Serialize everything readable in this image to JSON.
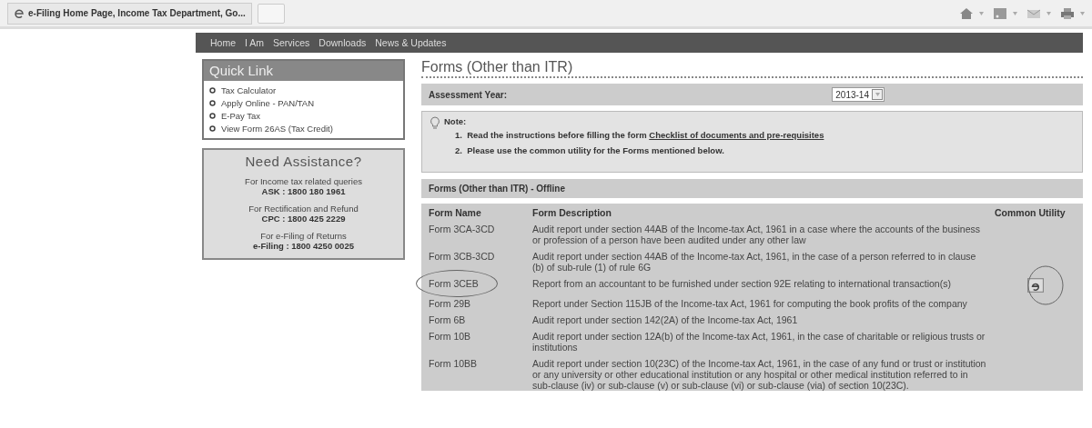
{
  "browser": {
    "tab_title": "e-Filing Home Page, Income Tax Department, Go...",
    "toolbar": [
      {
        "kind": "home"
      },
      {
        "kind": "feed"
      },
      {
        "kind": "mail"
      },
      {
        "kind": "print"
      }
    ]
  },
  "nav": [
    "Home",
    "I Am",
    "Services",
    "Downloads",
    "News & Updates"
  ],
  "quick_link": {
    "title": "Quick Link",
    "items": [
      "Tax Calculator",
      "Apply Online - PAN/TAN",
      "E-Pay Tax",
      "View Form 26AS (Tax Credit)"
    ]
  },
  "assistance": {
    "title": "Need Assistance?",
    "entries": [
      {
        "label": "For Income tax related queries",
        "line": "ASK : 1800 180 1961"
      },
      {
        "label": "For Rectification and Refund",
        "line": "CPC : 1800 425 2229"
      },
      {
        "label": "For e-Filing of Returns",
        "line": "e-Filing : 1800 4250 0025"
      }
    ]
  },
  "page_title": "Forms (Other than ITR)",
  "assessment": {
    "label": "Assessment Year:",
    "value": "2013-14"
  },
  "note": {
    "label": "Note:",
    "items": [
      {
        "number": "1.",
        "text": "Read the instructions before filling the form",
        "link": "Checklist of documents and pre-requisites"
      },
      {
        "number": "2.",
        "text": "Please use the common utility for the Forms mentioned below."
      }
    ]
  },
  "offline": {
    "title": "Forms (Other than ITR) - Offline",
    "columns": [
      "Form Name",
      "Form Description",
      "Common Utility"
    ],
    "rows": [
      {
        "name": "Form 3CA-3CD",
        "description": "Audit report under section 44AB of the Income-tax Act, 1961 in a case where the accounts of the business or profession of a person have been audited under any other law",
        "circled": false,
        "utility": false
      },
      {
        "name": "Form 3CB-3CD",
        "description": "Audit report under section 44AB of the Income-tax Act, 1961, in the case of a person referred to in clause (b) of sub-rule (1) of rule 6G",
        "circled": false,
        "utility": false
      },
      {
        "name": "Form 3CEB",
        "description": "Report from an accountant to be furnished under section 92E relating to international transaction(s)",
        "circled": true,
        "utility": true
      },
      {
        "name": "Form 29B",
        "description": "Report under Section 115JB of the Income-tax Act, 1961 for computing the book profits of the company",
        "circled": false,
        "utility": false
      },
      {
        "name": "Form 6B",
        "description": "Audit report under section 142(2A) of the Income-tax Act, 1961",
        "circled": false,
        "utility": false
      },
      {
        "name": "Form 10B",
        "description": "Audit report under section 12A(b) of the Income-tax Act, 1961, in the case of charitable or religious trusts or institutions",
        "circled": false,
        "utility": false
      },
      {
        "name": "Form 10BB",
        "description": "Audit report under section 10(23C) of the Income-tax Act, 1961, in the case of any fund or trust or institution or any university or other educational institution or any hospital or other medical institution referred to in sub-clause (iv) or sub-clause (v) or sub-clause (vi) or sub-clause (via) of section 10(23C).",
        "circled": false,
        "utility": false
      }
    ]
  }
}
